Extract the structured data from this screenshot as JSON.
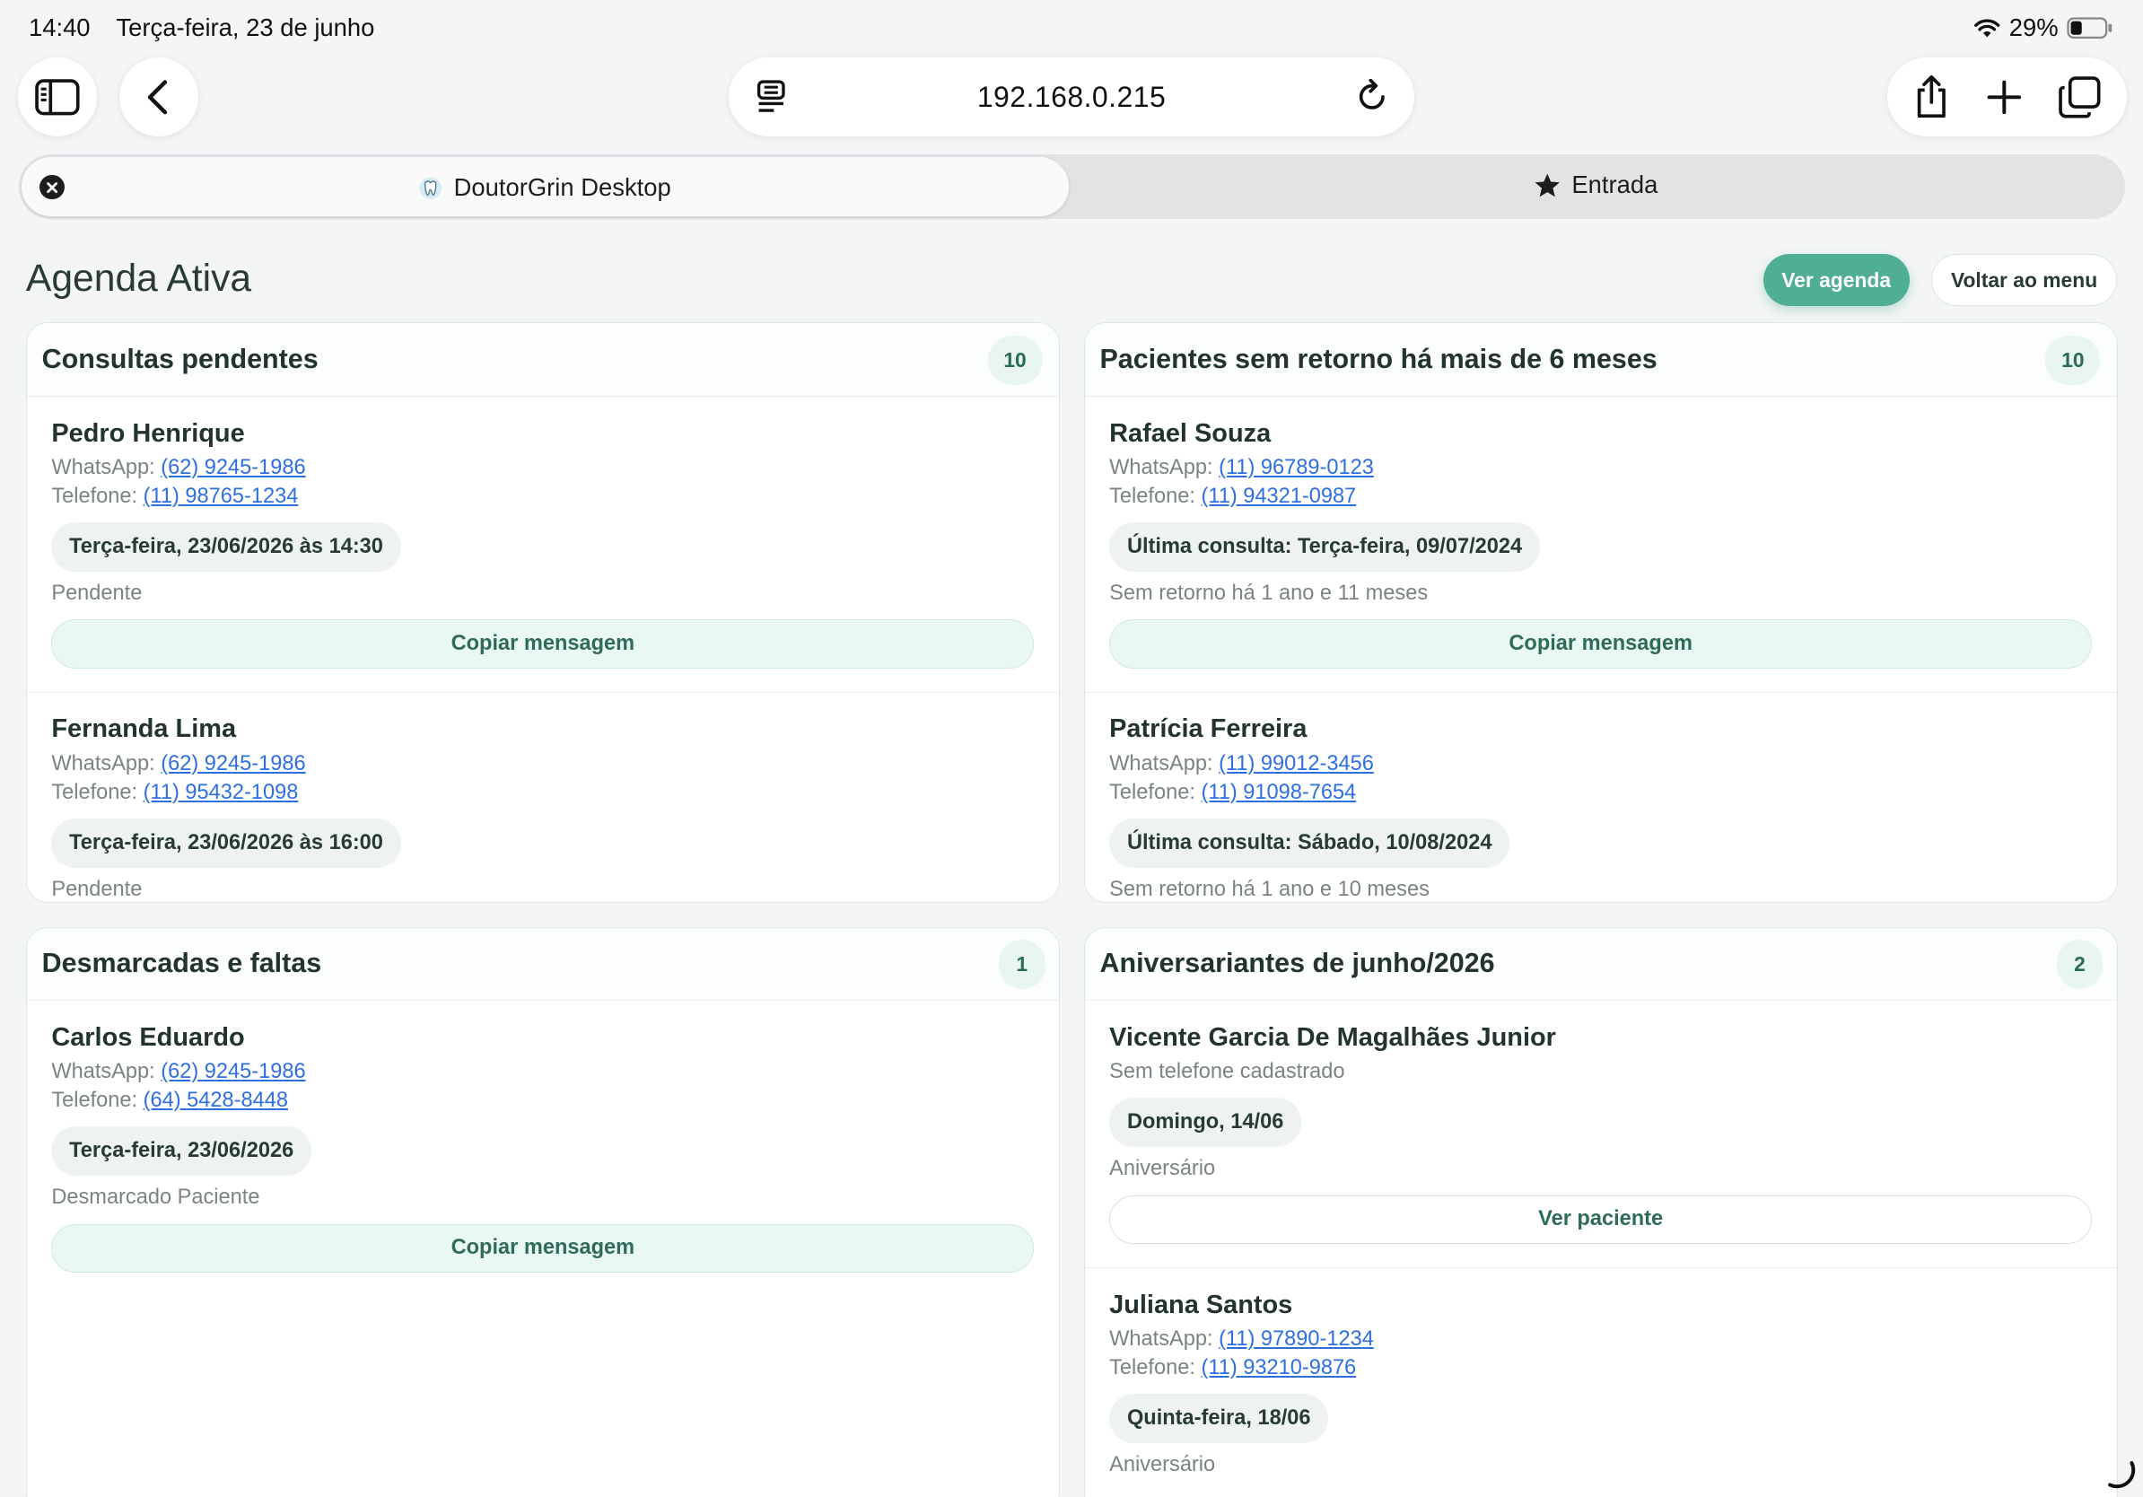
{
  "status_bar": {
    "time": "14:40",
    "date": "Terça-feira, 23 de junho",
    "battery": "29%"
  },
  "browser": {
    "url": "192.168.0.215",
    "tabs": [
      {
        "label": "DoutorGrin Desktop"
      },
      {
        "label": "Entrada"
      }
    ]
  },
  "page": {
    "title": "Agenda Ativa",
    "ver_agenda": "Ver agenda",
    "voltar_menu": "Voltar ao menu"
  },
  "cards": [
    {
      "title": "Consultas pendentes",
      "count": "10",
      "entries": [
        {
          "name": "Pedro Henrique",
          "wa_label": "WhatsApp:",
          "whatsapp": "(62) 9245-1986",
          "tel_label": "Telefone:",
          "telefone": "(11) 98765-1234",
          "pill": "Terça-feira, 23/06/2026 às 14:30",
          "status": "Pendente",
          "action": "Copiar mensagem"
        },
        {
          "name": "Fernanda Lima",
          "wa_label": "WhatsApp:",
          "whatsapp": "(62) 9245-1986",
          "tel_label": "Telefone:",
          "telefone": "(11) 95432-1098",
          "pill": "Terça-feira, 23/06/2026 às 16:00",
          "status": "Pendente"
        }
      ]
    },
    {
      "title": "Pacientes sem retorno há mais de 6 meses",
      "count": "10",
      "entries": [
        {
          "name": "Rafael Souza",
          "wa_label": "WhatsApp:",
          "whatsapp": "(11) 96789-0123",
          "tel_label": "Telefone:",
          "telefone": "(11) 94321-0987",
          "pill": "Última consulta: Terça-feira, 09/07/2024",
          "status": "Sem retorno há 1 ano e 11 meses",
          "action": "Copiar mensagem"
        },
        {
          "name": "Patrícia Ferreira",
          "wa_label": "WhatsApp:",
          "whatsapp": "(11) 99012-3456",
          "tel_label": "Telefone:",
          "telefone": "(11) 91098-7654",
          "pill": "Última consulta: Sábado, 10/08/2024",
          "status": "Sem retorno há 1 ano e 10 meses"
        }
      ]
    },
    {
      "title": "Desmarcadas e faltas",
      "count": "1",
      "entries": [
        {
          "name": "Carlos Eduardo",
          "wa_label": "WhatsApp:",
          "whatsapp": "(62) 9245-1986",
          "tel_label": "Telefone:",
          "telefone": "(64) 5428-8448",
          "pill": "Terça-feira, 23/06/2026",
          "status": "Desmarcado Paciente",
          "action": "Copiar mensagem"
        }
      ]
    },
    {
      "title": "Aniversariantes de junho/2026",
      "count": "2",
      "entries": [
        {
          "name": "Vicente Garcia De Magalhães Junior",
          "note": "Sem telefone cadastrado",
          "pill": "Domingo, 14/06",
          "status": "Aniversário",
          "action": "Ver paciente"
        },
        {
          "name": "Juliana Santos",
          "wa_label": "WhatsApp:",
          "whatsapp": "(11) 97890-1234",
          "tel_label": "Telefone:",
          "telefone": "(11) 93210-9876",
          "pill": "Quinta-feira, 18/06",
          "status": "Aniversário"
        }
      ]
    }
  ],
  "colors": {
    "accent": "#4fae93",
    "link": "#2e6fe0",
    "text": "#23332f"
  }
}
